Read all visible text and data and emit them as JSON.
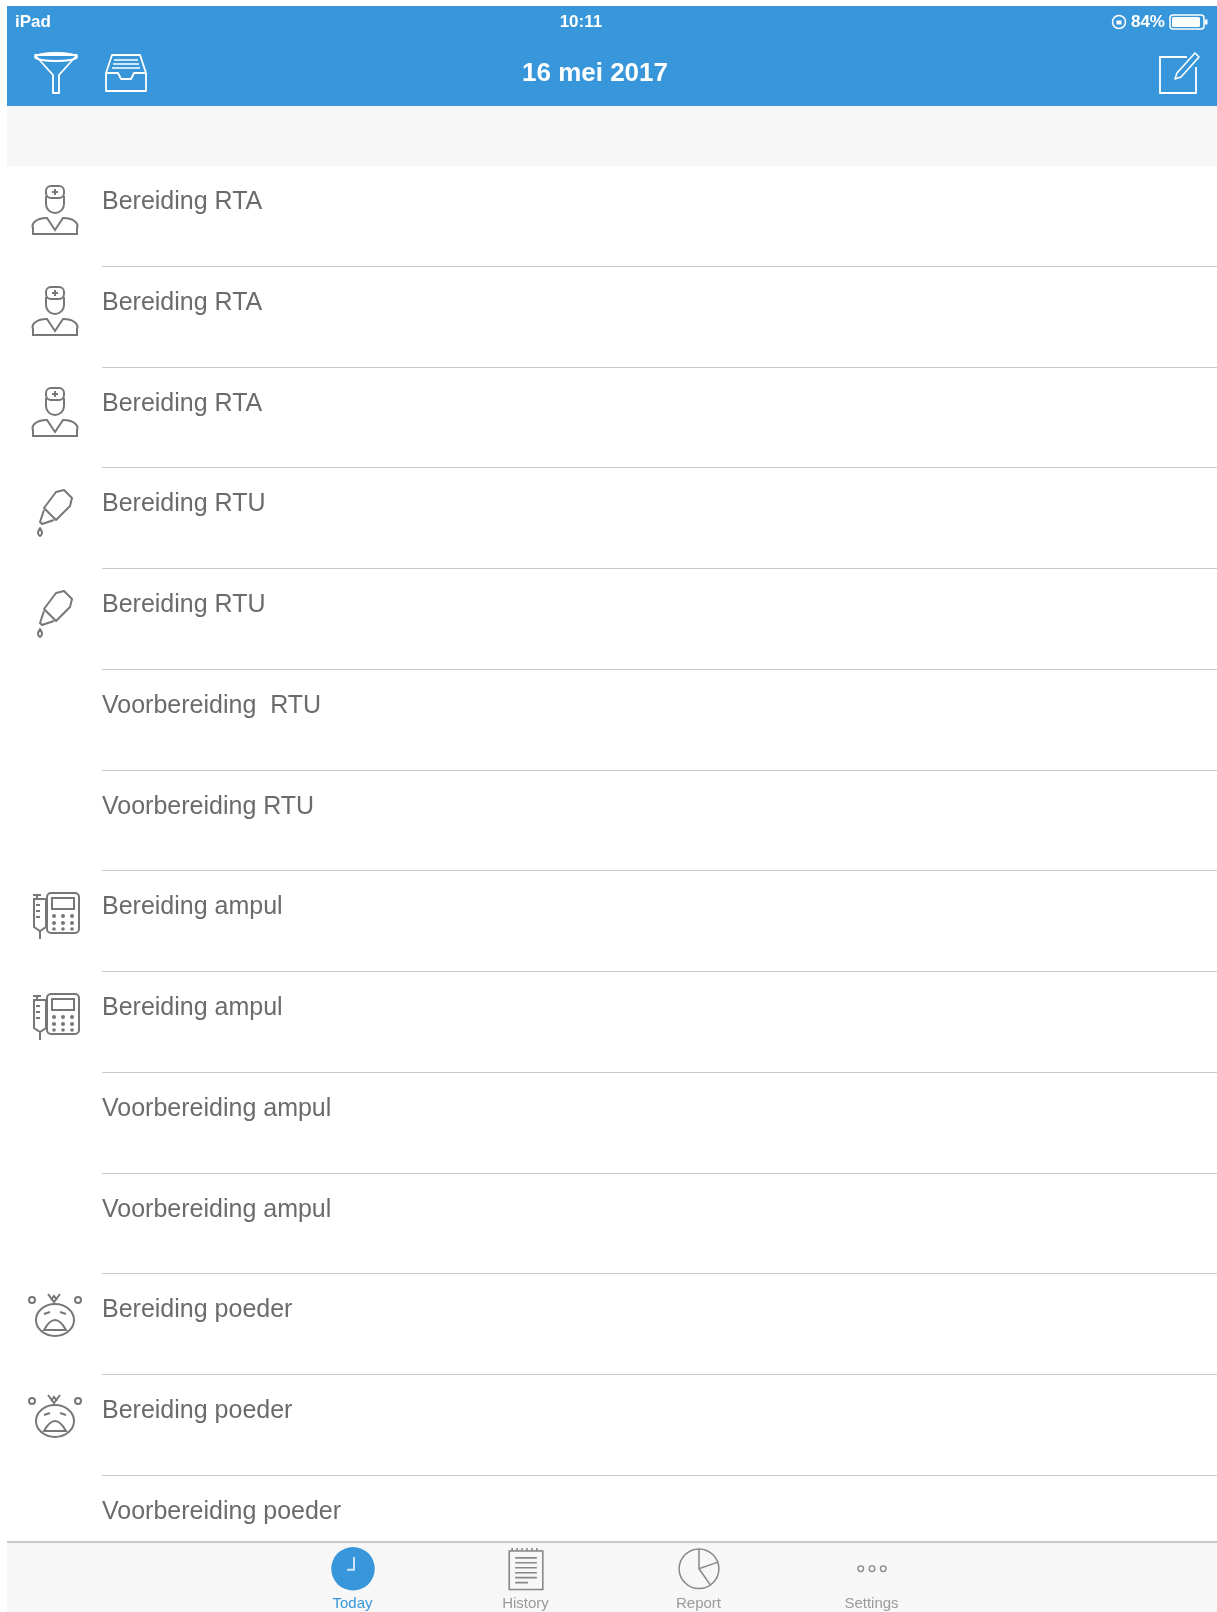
{
  "status_bar": {
    "device": "iPad",
    "time": "10:11",
    "battery": "84%"
  },
  "nav_bar": {
    "title": "16 mei 2017"
  },
  "rows": [
    {
      "kind": "doctor",
      "label": "Bereiding RTA"
    },
    {
      "kind": "doctor",
      "label": "Bereiding RTA"
    },
    {
      "kind": "doctor",
      "label": "Bereiding RTA"
    },
    {
      "kind": "dropper",
      "label": "Bereiding RTU"
    },
    {
      "kind": "dropper",
      "label": "Bereiding RTU"
    },
    {
      "kind": "none",
      "label": "Voorbereiding  RTU"
    },
    {
      "kind": "none",
      "label": "Voorbereiding RTU"
    },
    {
      "kind": "pump",
      "label": "Bereiding ampul"
    },
    {
      "kind": "pump",
      "label": "Bereiding ampul"
    },
    {
      "kind": "none",
      "label": "Voorbereiding ampul"
    },
    {
      "kind": "none",
      "label": "Voorbereiding ampul"
    },
    {
      "kind": "baby",
      "label": "Bereiding poeder"
    },
    {
      "kind": "baby",
      "label": "Bereiding poeder"
    },
    {
      "kind": "none",
      "label": "Voorbereiding poeder"
    }
  ],
  "tab_bar": [
    {
      "kind": "clock",
      "label": "Today",
      "selected": true
    },
    {
      "kind": "notepad",
      "label": "History",
      "selected": false
    },
    {
      "kind": "pie",
      "label": "Report",
      "selected": false
    },
    {
      "kind": "dots",
      "label": "Settings",
      "selected": false
    }
  ]
}
